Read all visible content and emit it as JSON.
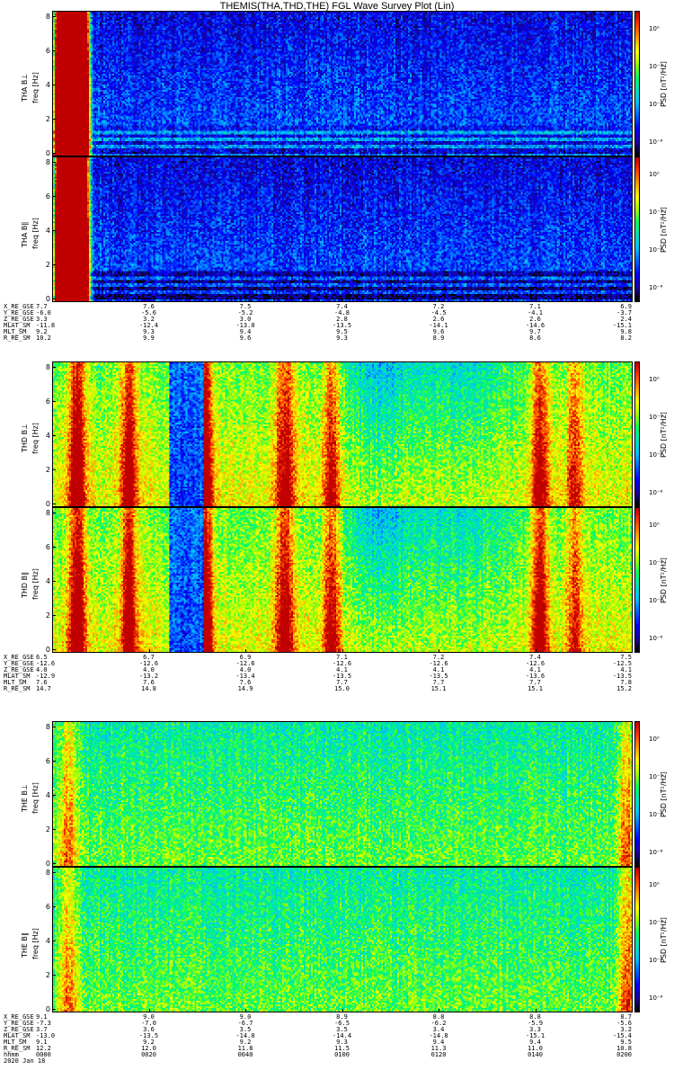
{
  "title": "THEMIS(THA,THD,THE) FGL Wave Survey Plot (Lin)",
  "colors": {
    "colormap": [
      "#000000",
      "#1a00a0",
      "#0000ff",
      "#0060ff",
      "#00c0ff",
      "#00e0c0",
      "#00ff60",
      "#a0ff00",
      "#ffff00",
      "#ffa000",
      "#ff4000",
      "#c00000"
    ]
  },
  "y_ticks": [
    "0",
    "2",
    "4",
    "6",
    "8"
  ],
  "colorbar_unit": "PSD [nT²/Hz]",
  "colorbar_ticks": [
    "10⁰",
    "10⁻²",
    "10⁻⁴",
    "10⁻⁶"
  ],
  "time_axis": {
    "label": "hhmm",
    "date": "2020 Jan 18",
    "ticks": [
      "0000",
      "0020",
      "0040",
      "0100",
      "0120",
      "0140",
      "0200"
    ]
  },
  "chart_data": [
    {
      "type": "heatmap",
      "spacecraft": "THA",
      "panels": [
        {
          "ylabel": "THA B⊥",
          "yunit": "freq [Hz]",
          "ylim": [
            0,
            8
          ]
        },
        {
          "ylabel": "THA B∥",
          "yunit": "freq [Hz]",
          "ylim": [
            0,
            8
          ]
        }
      ],
      "zscale": "log",
      "level_profile": {
        "base": 0.28,
        "bursts": [
          [
            2.0,
            0.9,
            6.5
          ],
          [
            4.5,
            0.8,
            4.5
          ]
        ],
        "bands_low_freq": true
      },
      "orbit": [
        {
          "label": "X_RE_GSE",
          "values": [
            "7.7",
            "7.6",
            "7.5",
            "7.4",
            "7.2",
            "7.1",
            "6.9"
          ]
        },
        {
          "label": "Y_RE_GSE",
          "values": [
            "-6.0",
            "-5.6",
            "-5.2",
            "-4.8",
            "-4.5",
            "-4.1",
            "-3.7"
          ]
        },
        {
          "label": "Z_RE_GSE",
          "values": [
            "3.3",
            "3.2",
            "3.0",
            "2.8",
            "2.6",
            "2.6",
            "2.4"
          ]
        },
        {
          "label": "MLAT_SM",
          "values": [
            "-11.8",
            "-12.4",
            "-13.0",
            "-13.5",
            "-14.1",
            "-14.6",
            "-15.1"
          ]
        },
        {
          "label": "MLT_SM",
          "values": [
            "9.2",
            "9.3",
            "9.4",
            "9.5",
            "9.6",
            "9.7",
            "9.8"
          ]
        },
        {
          "label": "R_RE_SM",
          "values": [
            "10.2",
            "9.9",
            "9.6",
            "9.3",
            "8.9",
            "8.6",
            "8.2"
          ]
        }
      ]
    },
    {
      "type": "heatmap",
      "spacecraft": "THD",
      "panels": [
        {
          "ylabel": "THD B⊥",
          "yunit": "freq [Hz]",
          "ylim": [
            0,
            8
          ]
        },
        {
          "ylabel": "THD B∥",
          "yunit": "freq [Hz]",
          "ylim": [
            0,
            8
          ]
        }
      ],
      "zscale": "log",
      "level_profile": {
        "base": 0.72,
        "quiet_interval": [
          20,
          26
        ],
        "bursts": [
          [
            4,
            1.0,
            0.55
          ],
          [
            13,
            1.0,
            0.5
          ],
          [
            26,
            1.0,
            0.6
          ],
          [
            40,
            1.2,
            0.45
          ],
          [
            48,
            1.0,
            0.4
          ],
          [
            84,
            1.0,
            0.45
          ],
          [
            90,
            1.0,
            0.3
          ]
        ],
        "dip": [
          [
            56,
            4.0,
            0.15
          ],
          [
            70,
            7.0,
            0.12
          ]
        ]
      },
      "orbit": [
        {
          "label": "X_RE_GSE",
          "values": [
            "6.5",
            "6.7",
            "6.9",
            "7.1",
            "7.2",
            "7.4",
            "7.5"
          ]
        },
        {
          "label": "Y_RE_GSE",
          "values": [
            "-12.6",
            "-12.6",
            "-12.6",
            "-12.6",
            "-12.6",
            "-12.6",
            "-12.5"
          ]
        },
        {
          "label": "Z_RE_GSE",
          "values": [
            "4.0",
            "4.0",
            "4.0",
            "4.1",
            "4.1",
            "4.1",
            "4.1"
          ]
        },
        {
          "label": "MLAT_SM",
          "values": [
            "-12.9",
            "-13.2",
            "-13.4",
            "-13.5",
            "-13.5",
            "-13.6",
            "-13.5"
          ]
        },
        {
          "label": "MLT_SM",
          "values": [
            "7.6",
            "7.6",
            "7.6",
            "7.7",
            "7.7",
            "7.7",
            "7.8"
          ]
        },
        {
          "label": "R_RE_SM",
          "values": [
            "14.7",
            "14.8",
            "14.9",
            "15.0",
            "15.1",
            "15.1",
            "15.2"
          ]
        }
      ]
    },
    {
      "type": "heatmap",
      "spacecraft": "THE",
      "panels": [
        {
          "ylabel": "THE B⊥",
          "yunit": "freq [Hz]",
          "ylim": [
            0,
            8
          ]
        },
        {
          "ylabel": "THE B∥",
          "yunit": "freq [Hz]",
          "ylim": [
            0,
            8
          ]
        }
      ],
      "zscale": "log",
      "level_profile": {
        "base": 0.6,
        "bursts": [
          [
            2.5,
            1.2,
            0.3
          ],
          [
            99,
            1.0,
            0.35
          ]
        ]
      },
      "orbit": [
        {
          "label": "X_RE_GSE",
          "values": [
            "9.1",
            "9.0",
            "9.0",
            "8.9",
            "8.8",
            "8.8",
            "8.7"
          ]
        },
        {
          "label": "Y_RE_GSE",
          "values": [
            "-7.3",
            "-7.0",
            "-6.7",
            "-6.5",
            "-6.2",
            "-5.9",
            "-5.6"
          ]
        },
        {
          "label": "Z_RE_GSE",
          "values": [
            "3.7",
            "3.6",
            "3.5",
            "3.5",
            "3.4",
            "3.3",
            "3.2"
          ]
        },
        {
          "label": "MLAT_SM",
          "values": [
            "-13.0",
            "-13.5",
            "-14.0",
            "-14.4",
            "-14.8",
            "-15.1",
            "-15.4"
          ]
        },
        {
          "label": "MLT_SM",
          "values": [
            "9.1",
            "9.2",
            "9.2",
            "9.3",
            "9.4",
            "9.4",
            "9.5"
          ]
        },
        {
          "label": "R_RE_SM",
          "values": [
            "12.2",
            "12.0",
            "11.8",
            "11.5",
            "11.3",
            "11.0",
            "10.8"
          ]
        }
      ]
    }
  ]
}
